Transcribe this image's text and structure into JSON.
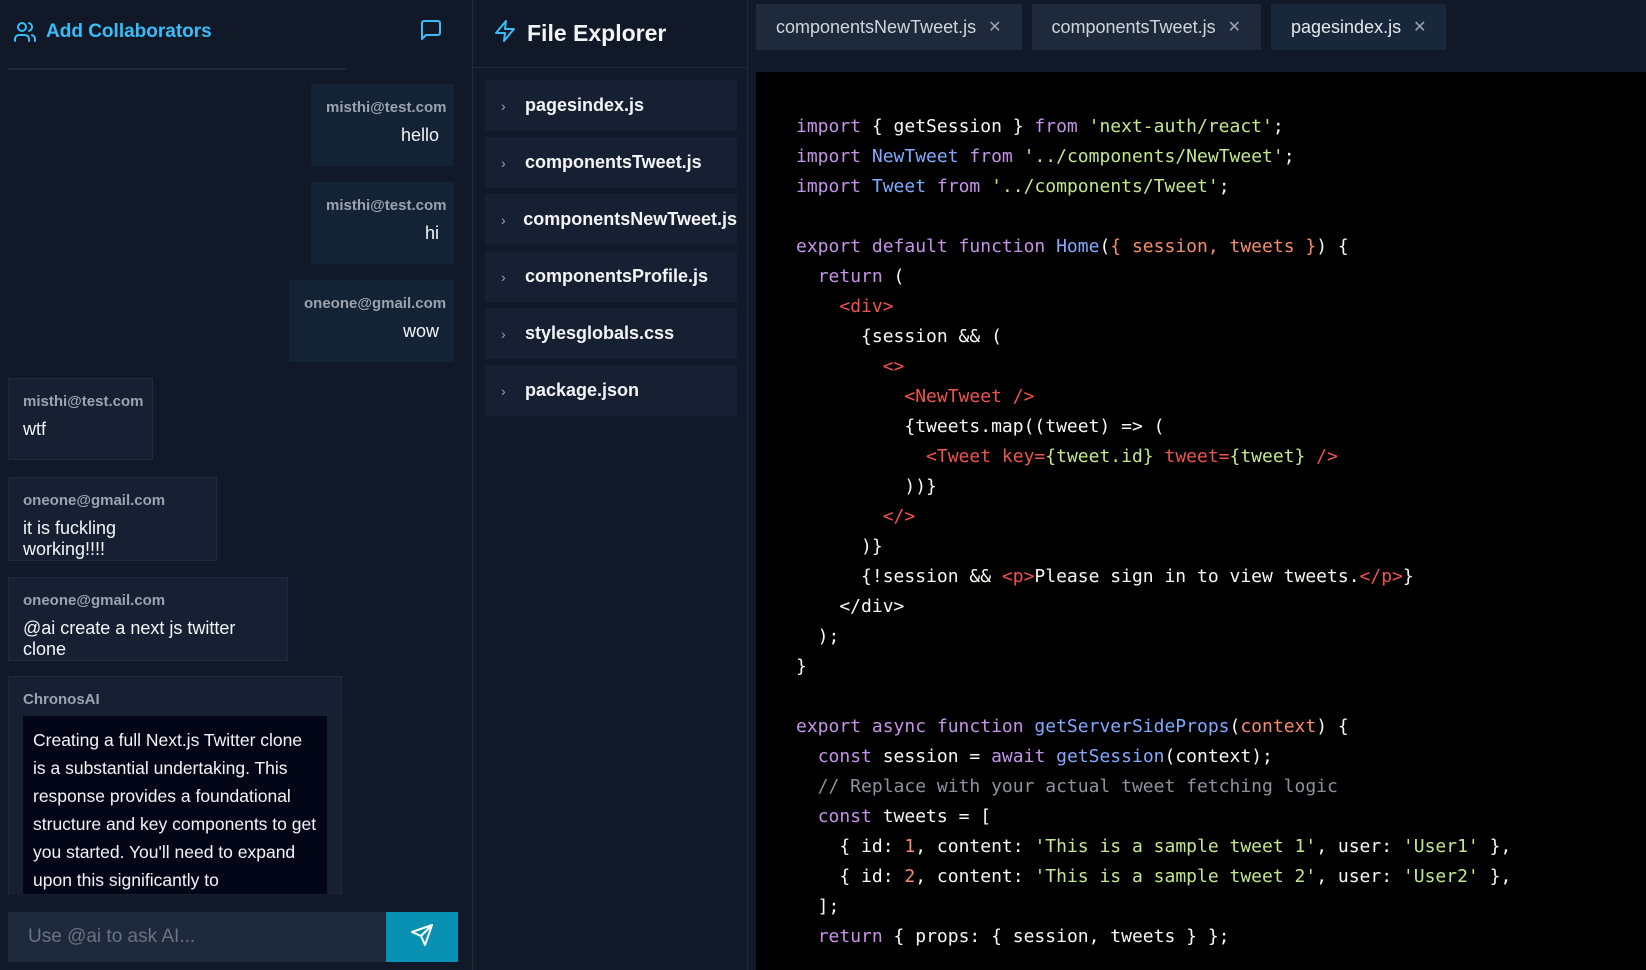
{
  "chat": {
    "title": "Add Collaborators",
    "messages": [
      {
        "from": "misthi@test.com",
        "text": "hello",
        "self": true
      },
      {
        "from": "misthi@test.com",
        "text": "hi",
        "self": true
      },
      {
        "from": "oneone@gmail.com",
        "text": "wow",
        "self": true
      },
      {
        "from": "misthi@test.com",
        "text": "wtf",
        "self": false
      },
      {
        "from": "oneone@gmail.com",
        "text": "it is fuckling working!!!!",
        "self": false
      },
      {
        "from": "oneone@gmail.com",
        "text": "@ai create a next js twitter clone",
        "self": false
      },
      {
        "from": "ChronosAI",
        "text": "Creating a full Next.js Twitter clone is a substantial undertaking. This response provides a foundational structure and key components to get you started. You'll need to expand upon this significantly to",
        "self": false
      }
    ],
    "input_placeholder": "Use @ai to ask AI..."
  },
  "explorer": {
    "title": "File Explorer",
    "files": [
      "pagesindex.js",
      "componentsTweet.js",
      "componentsNewTweet.js",
      "componentsProfile.js",
      "stylesglobals.css",
      "package.json"
    ]
  },
  "editor": {
    "tabs": [
      {
        "label": "componentsNewTweet.js",
        "active": false
      },
      {
        "label": "componentsTweet.js",
        "active": false
      },
      {
        "label": "pagesindex.js",
        "active": true
      }
    ],
    "code": {
      "l1": {
        "a": "import",
        "b": " { getSession } ",
        "c": "from",
        "d": " ",
        "e": "'next-auth/react'",
        "f": ";"
      },
      "l2": {
        "a": "import",
        "b": " ",
        "c": "NewTweet",
        "d": " ",
        "e": "from",
        "f": " ",
        "g": "'../components/NewTweet'",
        "h": ";"
      },
      "l3": {
        "a": "import",
        "b": " ",
        "c": "Tweet",
        "d": " ",
        "e": "from",
        "f": " ",
        "g": "'../components/Tweet'",
        "h": ";"
      },
      "l5": {
        "a": "export default function",
        "b": " ",
        "c": "Home",
        "d": "(",
        "e": "{ session, tweets }",
        "f": ") {"
      },
      "l6": {
        "a": "  ",
        "b": "return",
        "c": " ("
      },
      "l7": {
        "a": "    ",
        "b": "<div>"
      },
      "l8": {
        "a": "      {session && ("
      },
      "l9": {
        "a": "        ",
        "b": "<>"
      },
      "l10": {
        "a": "          ",
        "b": "<NewTweet />"
      },
      "l11": {
        "a": "          {tweets.map((tweet) => ("
      },
      "l12": {
        "a": "            ",
        "b": "<Tweet key=",
        "c": "{tweet.id}",
        "d": " tweet=",
        "e": "{tweet}",
        "f": " />"
      },
      "l13": {
        "a": "          ))}"
      },
      "l14": {
        "a": "        ",
        "b": "</>"
      },
      "l15": {
        "a": "      )}"
      },
      "l16": {
        "a": "      {!session && ",
        "b": "<p>",
        "c": "Please sign in to view tweets.",
        "d": "</p>",
        "e": "}"
      },
      "l17": {
        "a": "    </div>"
      },
      "l18": {
        "a": "  );"
      },
      "l19": {
        "a": "}"
      },
      "l21": {
        "a": "export async function",
        "b": " ",
        "c": "getServerSideProps",
        "d": "(",
        "e": "context",
        "f": ") {"
      },
      "l22": {
        "a": "  ",
        "b": "const",
        "c": " session = ",
        "d": "await",
        "e": " ",
        "f": "getSession",
        "g": "(context);"
      },
      "l23": {
        "a": "  // Replace with your actual tweet fetching logic"
      },
      "l24": {
        "a": "  ",
        "b": "const",
        "c": " tweets = ["
      },
      "l25": {
        "a": "    { id: ",
        "b": "1",
        "c": ", content: ",
        "d": "'This is a sample tweet 1'",
        "e": ", user: ",
        "f": "'User1'",
        "g": " },"
      },
      "l26": {
        "a": "    { id: ",
        "b": "2",
        "c": ", content: ",
        "d": "'This is a sample tweet 2'",
        "e": ", user: ",
        "f": "'User2'",
        "g": " },"
      },
      "l27": {
        "a": "  ];"
      },
      "l28": {
        "a": "  ",
        "b": "return",
        "c": " { props: { session, tweets } };"
      }
    }
  },
  "colors": {
    "accent": "#38bdf8",
    "send": "#0891b2"
  },
  "icons": [
    "users-icon",
    "message-square-icon",
    "zap-icon",
    "chevron-right-icon",
    "close-icon",
    "send-icon"
  ]
}
